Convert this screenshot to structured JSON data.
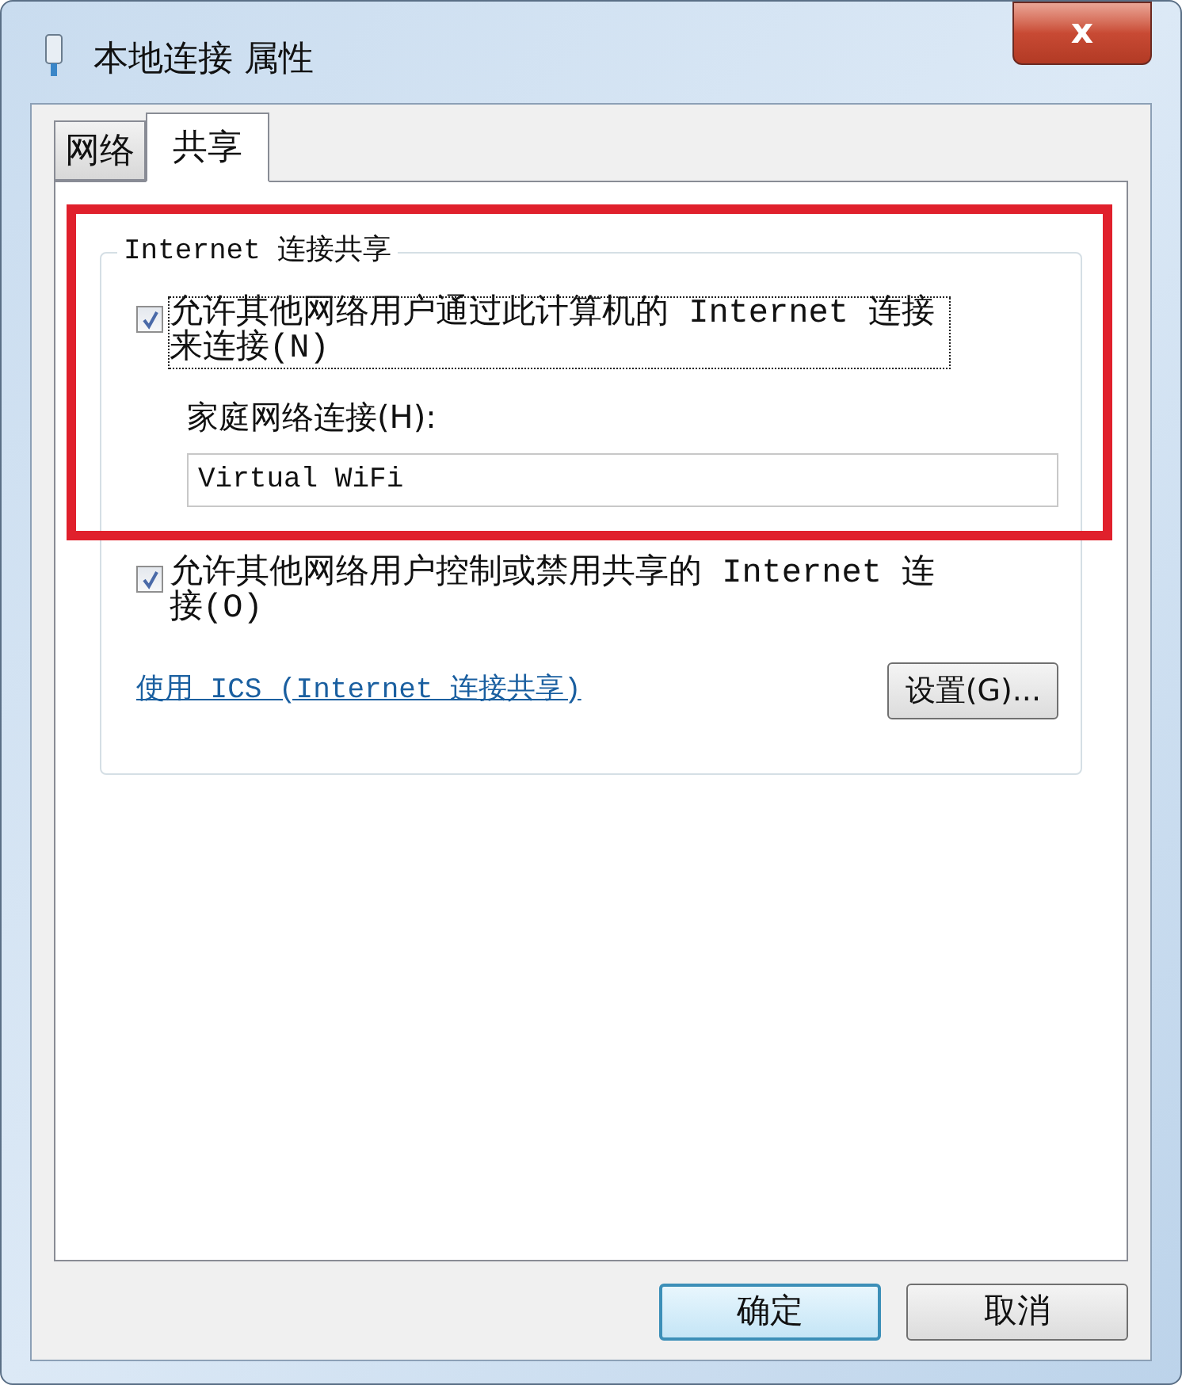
{
  "window": {
    "title": "本地连接 属性",
    "close": "x"
  },
  "tabs": [
    {
      "label": "网络",
      "selected": false
    },
    {
      "label": "共享",
      "selected": true
    }
  ],
  "group": {
    "legend": "Internet 连接共享",
    "allow_sharing": {
      "label": "允许其他网络用户通过此计算机的 Internet 连接来连接(N)",
      "checked": true,
      "focused": true
    },
    "home_network": {
      "label": "家庭网络连接(H):",
      "value": "Virtual WiFi"
    },
    "allow_control": {
      "label": "允许其他网络用户控制或禁用共享的 Internet 连接(O)",
      "checked": true,
      "focused": false
    },
    "link": "使用 ICS (Internet 连接共享)",
    "settings_button": "设置(G)..."
  },
  "buttons": [
    {
      "label": "确定",
      "default": true
    },
    {
      "label": "取消",
      "default": false
    }
  ]
}
